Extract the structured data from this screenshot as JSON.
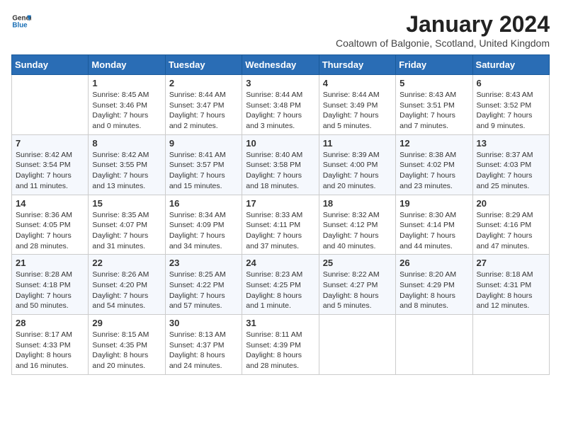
{
  "logo": {
    "line1": "General",
    "line2": "Blue"
  },
  "title": "January 2024",
  "subtitle": "Coaltown of Balgonie, Scotland, United Kingdom",
  "weekdays": [
    "Sunday",
    "Monday",
    "Tuesday",
    "Wednesday",
    "Thursday",
    "Friday",
    "Saturday"
  ],
  "weeks": [
    [
      {
        "day": "",
        "info": ""
      },
      {
        "day": "1",
        "info": "Sunrise: 8:45 AM\nSunset: 3:46 PM\nDaylight: 7 hours\nand 0 minutes."
      },
      {
        "day": "2",
        "info": "Sunrise: 8:44 AM\nSunset: 3:47 PM\nDaylight: 7 hours\nand 2 minutes."
      },
      {
        "day": "3",
        "info": "Sunrise: 8:44 AM\nSunset: 3:48 PM\nDaylight: 7 hours\nand 3 minutes."
      },
      {
        "day": "4",
        "info": "Sunrise: 8:44 AM\nSunset: 3:49 PM\nDaylight: 7 hours\nand 5 minutes."
      },
      {
        "day": "5",
        "info": "Sunrise: 8:43 AM\nSunset: 3:51 PM\nDaylight: 7 hours\nand 7 minutes."
      },
      {
        "day": "6",
        "info": "Sunrise: 8:43 AM\nSunset: 3:52 PM\nDaylight: 7 hours\nand 9 minutes."
      }
    ],
    [
      {
        "day": "7",
        "info": "Sunrise: 8:42 AM\nSunset: 3:54 PM\nDaylight: 7 hours\nand 11 minutes."
      },
      {
        "day": "8",
        "info": "Sunrise: 8:42 AM\nSunset: 3:55 PM\nDaylight: 7 hours\nand 13 minutes."
      },
      {
        "day": "9",
        "info": "Sunrise: 8:41 AM\nSunset: 3:57 PM\nDaylight: 7 hours\nand 15 minutes."
      },
      {
        "day": "10",
        "info": "Sunrise: 8:40 AM\nSunset: 3:58 PM\nDaylight: 7 hours\nand 18 minutes."
      },
      {
        "day": "11",
        "info": "Sunrise: 8:39 AM\nSunset: 4:00 PM\nDaylight: 7 hours\nand 20 minutes."
      },
      {
        "day": "12",
        "info": "Sunrise: 8:38 AM\nSunset: 4:02 PM\nDaylight: 7 hours\nand 23 minutes."
      },
      {
        "day": "13",
        "info": "Sunrise: 8:37 AM\nSunset: 4:03 PM\nDaylight: 7 hours\nand 25 minutes."
      }
    ],
    [
      {
        "day": "14",
        "info": "Sunrise: 8:36 AM\nSunset: 4:05 PM\nDaylight: 7 hours\nand 28 minutes."
      },
      {
        "day": "15",
        "info": "Sunrise: 8:35 AM\nSunset: 4:07 PM\nDaylight: 7 hours\nand 31 minutes."
      },
      {
        "day": "16",
        "info": "Sunrise: 8:34 AM\nSunset: 4:09 PM\nDaylight: 7 hours\nand 34 minutes."
      },
      {
        "day": "17",
        "info": "Sunrise: 8:33 AM\nSunset: 4:11 PM\nDaylight: 7 hours\nand 37 minutes."
      },
      {
        "day": "18",
        "info": "Sunrise: 8:32 AM\nSunset: 4:12 PM\nDaylight: 7 hours\nand 40 minutes."
      },
      {
        "day": "19",
        "info": "Sunrise: 8:30 AM\nSunset: 4:14 PM\nDaylight: 7 hours\nand 44 minutes."
      },
      {
        "day": "20",
        "info": "Sunrise: 8:29 AM\nSunset: 4:16 PM\nDaylight: 7 hours\nand 47 minutes."
      }
    ],
    [
      {
        "day": "21",
        "info": "Sunrise: 8:28 AM\nSunset: 4:18 PM\nDaylight: 7 hours\nand 50 minutes."
      },
      {
        "day": "22",
        "info": "Sunrise: 8:26 AM\nSunset: 4:20 PM\nDaylight: 7 hours\nand 54 minutes."
      },
      {
        "day": "23",
        "info": "Sunrise: 8:25 AM\nSunset: 4:22 PM\nDaylight: 7 hours\nand 57 minutes."
      },
      {
        "day": "24",
        "info": "Sunrise: 8:23 AM\nSunset: 4:25 PM\nDaylight: 8 hours\nand 1 minute."
      },
      {
        "day": "25",
        "info": "Sunrise: 8:22 AM\nSunset: 4:27 PM\nDaylight: 8 hours\nand 5 minutes."
      },
      {
        "day": "26",
        "info": "Sunrise: 8:20 AM\nSunset: 4:29 PM\nDaylight: 8 hours\nand 8 minutes."
      },
      {
        "day": "27",
        "info": "Sunrise: 8:18 AM\nSunset: 4:31 PM\nDaylight: 8 hours\nand 12 minutes."
      }
    ],
    [
      {
        "day": "28",
        "info": "Sunrise: 8:17 AM\nSunset: 4:33 PM\nDaylight: 8 hours\nand 16 minutes."
      },
      {
        "day": "29",
        "info": "Sunrise: 8:15 AM\nSunset: 4:35 PM\nDaylight: 8 hours\nand 20 minutes."
      },
      {
        "day": "30",
        "info": "Sunrise: 8:13 AM\nSunset: 4:37 PM\nDaylight: 8 hours\nand 24 minutes."
      },
      {
        "day": "31",
        "info": "Sunrise: 8:11 AM\nSunset: 4:39 PM\nDaylight: 8 hours\nand 28 minutes."
      },
      {
        "day": "",
        "info": ""
      },
      {
        "day": "",
        "info": ""
      },
      {
        "day": "",
        "info": ""
      }
    ]
  ]
}
